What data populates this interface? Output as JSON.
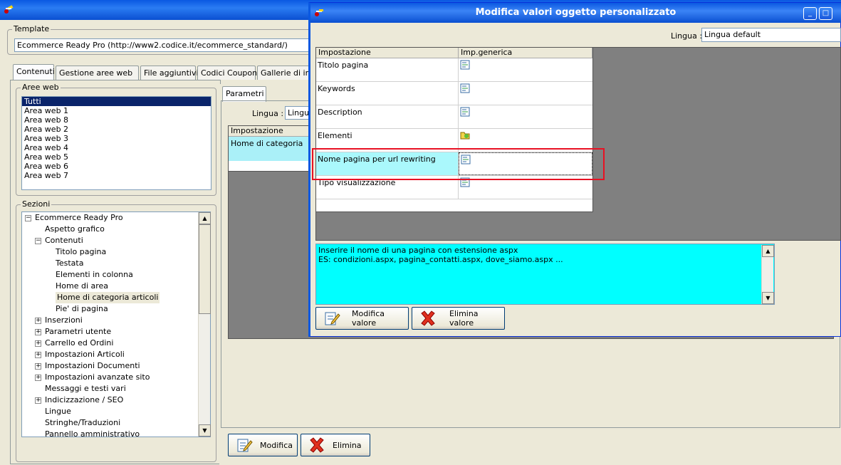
{
  "main": {
    "template": {
      "label": "Template",
      "value": "Ecommerce Ready Pro (http://www2.codice.it/ecommerce_standard/)"
    },
    "tabs": [
      "Contenuti",
      "Gestione aree web",
      "File aggiuntivi",
      "Codici Coupon",
      "Gallerie di immagini"
    ],
    "aree_web": {
      "label": "Aree web",
      "items": [
        "Tutti",
        "Area web 1",
        "Area web 8",
        "Area web 2",
        "Area web 3",
        "Area web 4",
        "Area web 5",
        "Area web 6",
        "Area web 7"
      ],
      "selected": "Tutti"
    },
    "sezioni": {
      "label": "Sezioni",
      "root": "Ecommerce Ready Pro",
      "items": [
        {
          "label": "Aspetto grafico",
          "level": 1,
          "toggle": ""
        },
        {
          "label": "Contenuti",
          "level": 1,
          "toggle": "-"
        },
        {
          "label": "Titolo pagina",
          "level": 2,
          "toggle": ""
        },
        {
          "label": "Testata",
          "level": 2,
          "toggle": ""
        },
        {
          "label": "Elementi in colonna",
          "level": 2,
          "toggle": ""
        },
        {
          "label": "Home di area",
          "level": 2,
          "toggle": ""
        },
        {
          "label": "Home di categoria articoli",
          "level": 2,
          "toggle": "",
          "selected": true
        },
        {
          "label": "Pie' di pagina",
          "level": 2,
          "toggle": ""
        },
        {
          "label": "Inserzioni",
          "level": 1,
          "toggle": "+"
        },
        {
          "label": "Parametri utente",
          "level": 1,
          "toggle": "+"
        },
        {
          "label": "Carrello ed Ordini",
          "level": 1,
          "toggle": "+"
        },
        {
          "label": "Impostazioni Articoli",
          "level": 1,
          "toggle": "+"
        },
        {
          "label": "Impostazioni Documenti",
          "level": 1,
          "toggle": "+"
        },
        {
          "label": "Impostazioni avanzate sito",
          "level": 1,
          "toggle": "+"
        },
        {
          "label": "Messaggi e testi vari",
          "level": 1,
          "toggle": ""
        },
        {
          "label": "Indicizzazione / SEO",
          "level": 1,
          "toggle": "+"
        },
        {
          "label": "Lingue",
          "level": 1,
          "toggle": ""
        },
        {
          "label": "Stringhe/Traduzioni",
          "level": 1,
          "toggle": ""
        },
        {
          "label": "Pannello amministrativo",
          "level": 1,
          "toggle": ""
        }
      ]
    },
    "parametri": {
      "tab": "Parametri",
      "lingua_label": "Lingua :",
      "lingua_value": "Lingua",
      "grid_header": "Impostazione",
      "grid_row": "Home di categoria"
    },
    "buttons": {
      "modifica": "Modifica",
      "elimina": "Elimina"
    }
  },
  "dialog": {
    "title": "Modifica valori oggetto personalizzato",
    "lingua_label": "Lingua :",
    "lingua_value": "Lingua default",
    "grid_headers": [
      "Impostazione",
      "Imp.generica"
    ],
    "rows": [
      {
        "name": "Titolo pagina",
        "icon": "text-edit-icon"
      },
      {
        "name": "Keywords",
        "icon": "text-edit-icon"
      },
      {
        "name": "Description",
        "icon": "text-edit-icon"
      },
      {
        "name": "Elementi",
        "icon": "folder-icon"
      },
      {
        "name": "Nome pagina per url rewriting",
        "icon": "text-edit-icon",
        "selected": true
      },
      {
        "name": "Tipo visualizzazione",
        "icon": "text-edit-icon"
      }
    ],
    "description_lines": [
      "Inserire il nome di una pagina con estensione aspx",
      "ES: condizioni.aspx, pagina_contatti.aspx, dove_siamo.aspx ..."
    ],
    "buttons": {
      "modifica_valore": "Modifica valore",
      "elimina_valore": "Elimina valore"
    },
    "highlight_color": "#e81123"
  }
}
